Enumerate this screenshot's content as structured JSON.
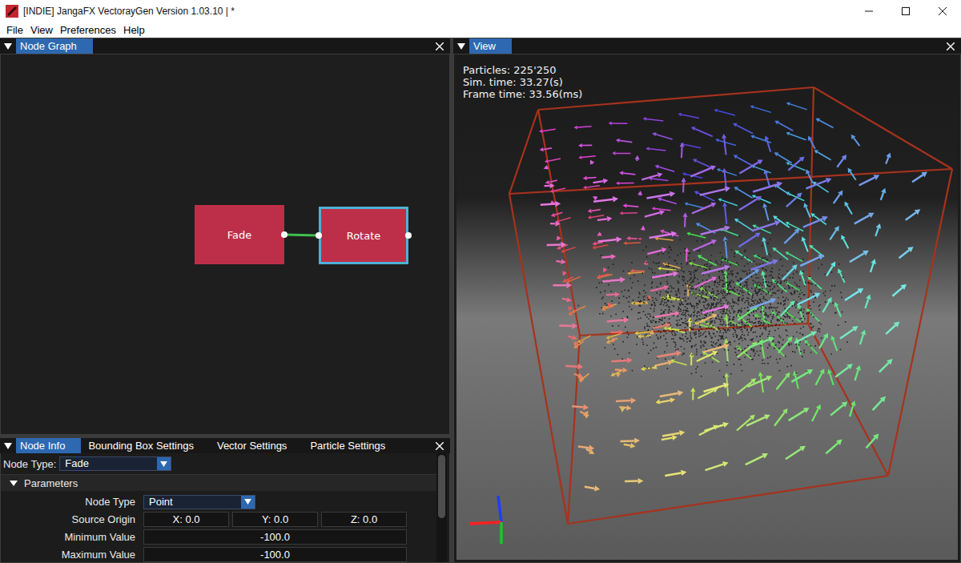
{
  "window": {
    "title": "[INDIE] JangaFX VectorayGen Version 1.03.10 | *"
  },
  "menu": [
    "File",
    "View",
    "Preferences",
    "Help"
  ],
  "node_graph": {
    "title": "Node Graph",
    "nodes": [
      {
        "label": "Fade",
        "selected": false
      },
      {
        "label": "Rotate",
        "selected": true
      }
    ],
    "links": [
      {
        "from": "Fade",
        "to": "Rotate"
      }
    ]
  },
  "inspector": {
    "tabs": [
      {
        "label": "Node Info",
        "selected": true
      },
      {
        "label": "Bounding Box Settings",
        "selected": false
      },
      {
        "label": "Vector Settings",
        "selected": false
      },
      {
        "label": "Particle Settings",
        "selected": false
      }
    ],
    "node_type_label": "Node Type:",
    "node_type": "Fade",
    "section": {
      "label": "Parameters",
      "expanded": true
    },
    "params": [
      {
        "kind": "select",
        "label": "Node Type",
        "values": [
          "Point"
        ]
      },
      {
        "kind": "vector",
        "label": "Source Origin",
        "values": [
          "X: 0.0",
          "Y: 0.0",
          "Z: 0.0"
        ]
      },
      {
        "kind": "number",
        "label": "Minimum Value",
        "values": [
          "-100.0"
        ]
      },
      {
        "kind": "number",
        "label": "Maximum Value",
        "values": [
          "-100.0"
        ]
      }
    ],
    "scrollbar": {
      "level": 0.6
    }
  },
  "view": {
    "title": "View",
    "stats": [
      "Particles: 225'250",
      "Sim. time: 33.27(s)",
      "Frame time: 33.56(ms)"
    ]
  }
}
